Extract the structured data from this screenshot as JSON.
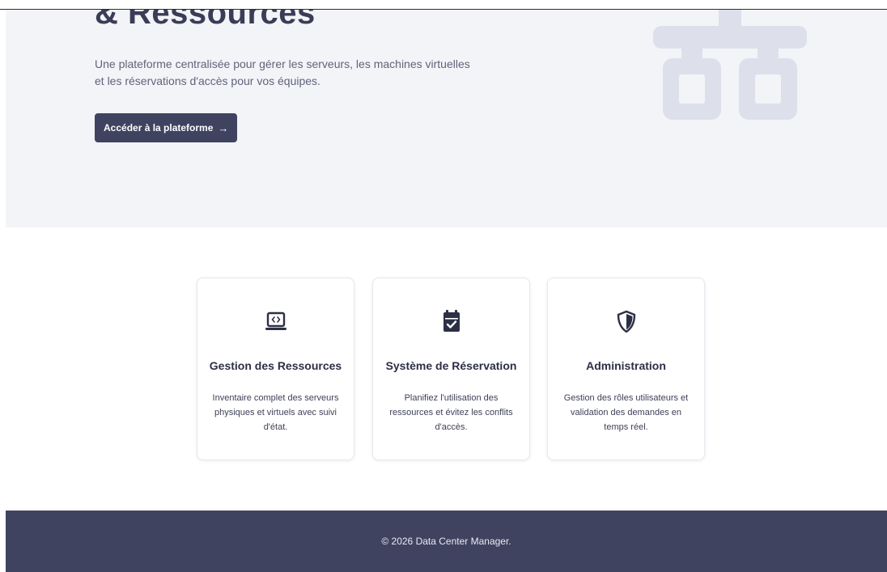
{
  "hero": {
    "title": "& Ressources",
    "description": "Une plateforme centralisée pour gérer les serveurs, les machines virtuelles et les réservations d'accès pour vos équipes.",
    "cta_label": "Accéder à la plateforme",
    "cta_icon": "arrow-right-icon"
  },
  "features": [
    {
      "icon": "laptop-code-icon",
      "title": "Gestion des Ressources",
      "description": "Inventaire complet des serveurs physiques et virtuels avec suivi d'état."
    },
    {
      "icon": "calendar-check-icon",
      "title": "Système de Réservation",
      "description": "Planifiez l'utilisation des ressources et évitez les conflits d'accès."
    },
    {
      "icon": "shield-icon",
      "title": "Administration",
      "description": "Gestion des rôles utilisateurs et validation des demandes en temps réel."
    }
  ],
  "footer": {
    "copyright": "© 2026 Data Center Manager."
  },
  "colors": {
    "primary": "#404360",
    "hero_background": "#f3f4f7",
    "hero_graphic": "#dde0ea",
    "text_dark": "#2d2f45",
    "text_muted": "#60637a"
  }
}
